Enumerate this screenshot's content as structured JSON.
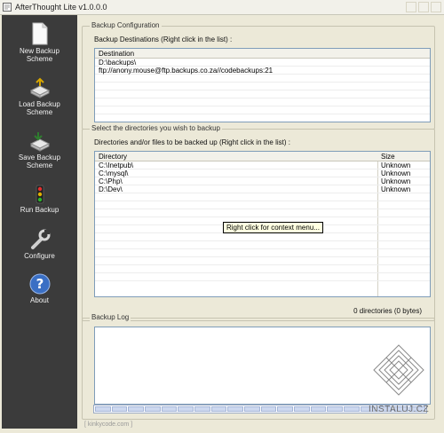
{
  "window": {
    "title": "AfterThought Lite v1.0.0.0"
  },
  "sidebar": {
    "items": [
      {
        "label_line1": "New Backup",
        "label_line2": "Scheme",
        "icon": "new-document-icon"
      },
      {
        "label_line1": "Load Backup",
        "label_line2": "Scheme",
        "icon": "load-scheme-icon"
      },
      {
        "label_line1": "Save Backup",
        "label_line2": "Scheme",
        "icon": "save-scheme-icon"
      },
      {
        "label_line1": "Run Backup",
        "label_line2": "",
        "icon": "traffic-light-icon"
      },
      {
        "label_line1": "Configure",
        "label_line2": "",
        "icon": "wrench-icon"
      },
      {
        "label_line1": "About",
        "label_line2": "",
        "icon": "help-icon"
      }
    ]
  },
  "config": {
    "group_title": "Backup Configuration",
    "caption": "Backup Destinations (Right click in the list) :",
    "column": "Destination",
    "rows": [
      "D:\\backups\\",
      "ftp://anony.mouse@ftp.backups.co.za//codebackups:21"
    ]
  },
  "directories": {
    "group_title": "Select the directories you wish to backup",
    "caption": "Directories and/or files to be backed up (Right click in the list) :",
    "columns": {
      "directory": "Directory",
      "size": "Size"
    },
    "rows": [
      {
        "path": "C:\\Inetpub\\",
        "size": "Unknown"
      },
      {
        "path": "C:\\mysql\\",
        "size": "Unknown"
      },
      {
        "path": "C:\\Php\\",
        "size": "Unknown"
      },
      {
        "path": "D:\\Dev\\",
        "size": "Unknown"
      }
    ],
    "tooltip": "Right click for context menu...",
    "status": "0 directories (0 bytes)"
  },
  "log": {
    "group_title": "Backup Log"
  },
  "footer": "[ kinkycode.com ]",
  "watermark": "INSTALUJ.CZ"
}
